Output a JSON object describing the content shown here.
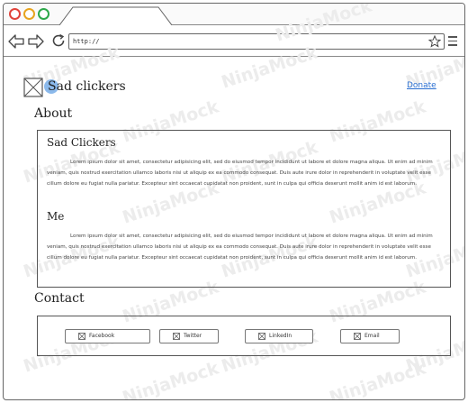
{
  "browser": {
    "url": "http://"
  },
  "watermark": {
    "text": "NinjaMock"
  },
  "site": {
    "title": "Sad clickers",
    "donate_label": "Donate"
  },
  "about": {
    "heading": "About",
    "sections": [
      {
        "title": "Sad  Clickers",
        "body": "Lorem ipsum dolor sit amet, consectetur adipisicing elit, sed do eiusmod tempor incididunt ut labore et dolore magna aliqua. Ut enim ad minim veniam, quis nostrud exercitation ullamco laboris nisi ut aliquip ex ea commodo consequat. Duis aute irure dolor in reprehenderit in voluptate velit esse cillum dolore eu fugiat nulla pariatur. Excepteur sint occaecat cupidatat non proident, sunt in culpa qui officia deserunt mollit anim id est laborum."
      },
      {
        "title": "Me",
        "body": "Lorem ipsum dolor sit amet, consectetur adipisicing elit, sed do eiusmod tempor incididunt ut labore et dolore magna aliqua. Ut enim ad minim veniam, quis nostrud exercitation ullamco laboris nisi ut aliquip ex ea commodo consequat. Duis aute irure dolor in reprehenderit in voluptate velit esse cillum dolore eu fugiat nulla pariatur. Excepteur sint occaecat cupidatat non proident, sunt in culpa qui officia deserunt mollit anim id est laborum."
      }
    ]
  },
  "contact": {
    "heading": "Contact",
    "buttons": [
      {
        "label": "Facebook",
        "icon": "image-placeholder-icon"
      },
      {
        "label": "Twitter",
        "icon": "image-placeholder-icon"
      },
      {
        "label": "LinkedIn",
        "icon": "image-placeholder-icon"
      },
      {
        "label": "Email",
        "icon": "image-placeholder-icon"
      }
    ]
  },
  "colors": {
    "close": "#e0433b",
    "minimize": "#e8a41e",
    "maximize": "#2da84a",
    "link": "#2a6fd1",
    "logo_blob": "#6ea7e6"
  }
}
